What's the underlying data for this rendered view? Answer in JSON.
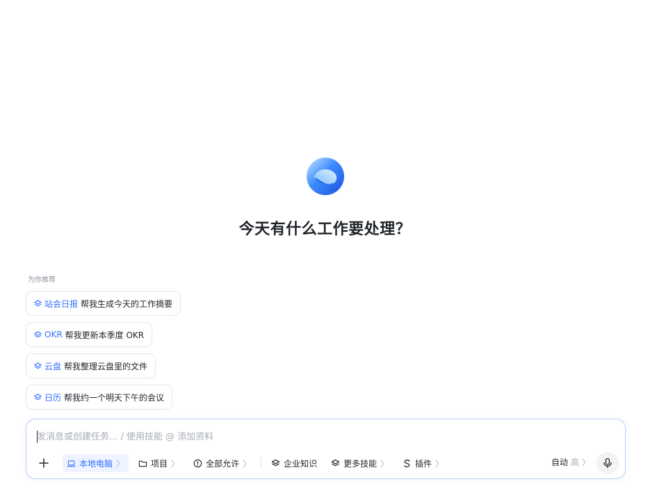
{
  "brand": {
    "logo_icon": "assistant-logo-icon",
    "accent": "#3370ff"
  },
  "headline": "今天有什么工作要处理？",
  "recommendations": {
    "title": "为你推荐",
    "items": [
      {
        "icon": "skill-icon",
        "tag": "站会日报",
        "text": "帮我生成今天的工作摘要"
      },
      {
        "icon": "skill-icon",
        "tag": "OKR",
        "text": "帮我更新本季度 OKR"
      },
      {
        "icon": "skill-icon",
        "tag": "云盘",
        "text": "帮我整理云盘里的文件"
      },
      {
        "icon": "skill-icon",
        "tag": "日历",
        "text": "帮我约一个明天下午的会议"
      }
    ]
  },
  "composer": {
    "placeholder": "发消息或创建任务... / 使用技能 @ 添加资料",
    "value": "",
    "toolbar": {
      "add": {
        "icon": "plus-icon"
      },
      "local_computer": {
        "icon": "laptop-icon",
        "label": "本地电脑",
        "chevron": "〉"
      },
      "project": {
        "icon": "folder-icon",
        "label": "项目",
        "chevron": "〉"
      },
      "permission": {
        "icon": "alert-circle-icon",
        "label": "全部允许",
        "chevron": "〉"
      },
      "knowledge": {
        "icon": "layers-icon",
        "label": "企业知识"
      },
      "more_skills": {
        "icon": "layers-icon",
        "label": "更多技能",
        "chevron": "〉"
      },
      "plugins": {
        "icon": "plugin-icon",
        "label": "插件",
        "chevron": "〉"
      }
    },
    "mode": {
      "label": "自动",
      "level": "高",
      "chevron": "〉"
    },
    "mic": {
      "icon": "microphone-icon"
    }
  }
}
